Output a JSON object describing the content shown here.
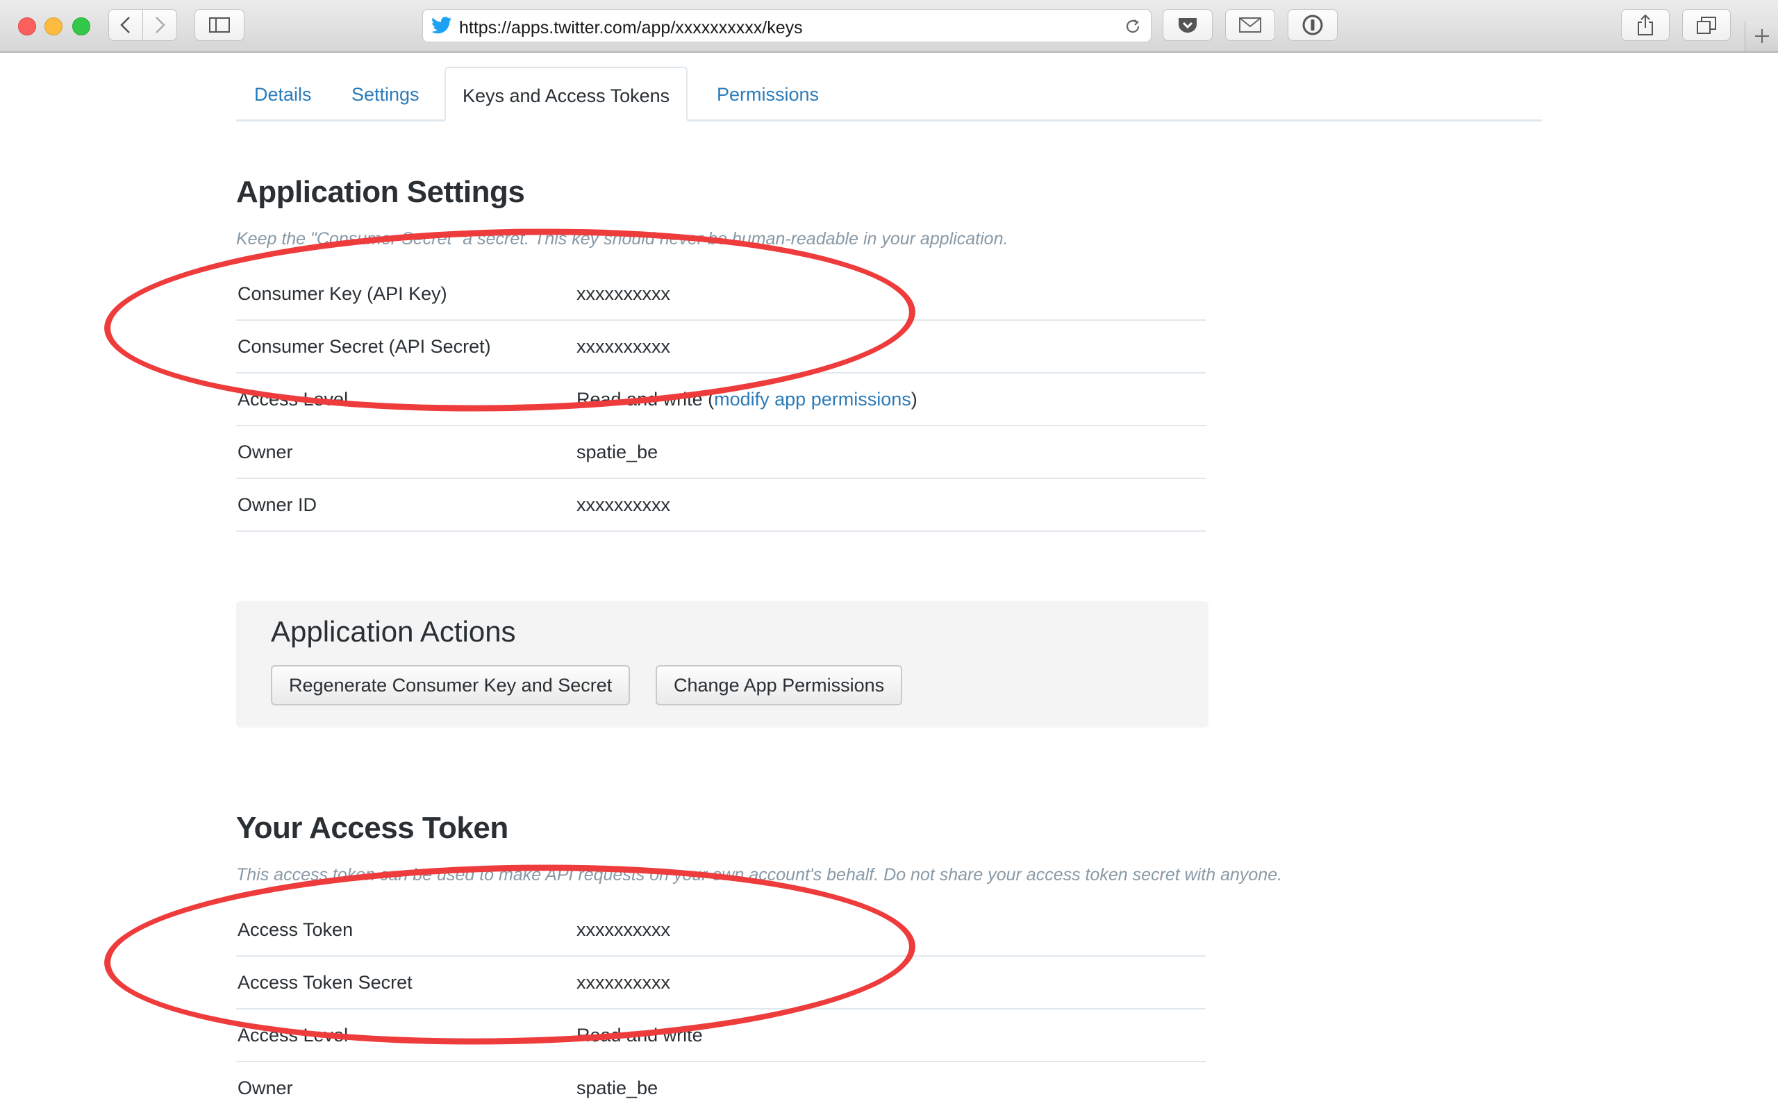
{
  "browser": {
    "url": "https://apps.twitter.com/app/xxxxxxxxxx/keys",
    "icons": [
      "back-icon",
      "forward-icon",
      "sidebar-icon",
      "twitter-bird-icon",
      "reload-icon",
      "pocket-icon",
      "mail-icon",
      "onepassword-icon",
      "share-icon",
      "tabs-icon",
      "new-tab-icon"
    ]
  },
  "tabs": [
    {
      "label": "Details"
    },
    {
      "label": "Settings"
    },
    {
      "label": "Keys and Access Tokens"
    },
    {
      "label": "Permissions"
    }
  ],
  "app_settings": {
    "title": "Application Settings",
    "description": "Keep the \"Consumer Secret\" a secret. This key should never be human-readable in your application.",
    "rows": [
      {
        "key": "Consumer Key (API Key)",
        "value": "xxxxxxxxxx"
      },
      {
        "key": "Consumer Secret (API Secret)",
        "value": "xxxxxxxxxx"
      },
      {
        "key": "Access Level",
        "value": "Read and write",
        "link_open": "(",
        "link": "modify app permissions",
        "link_close": ")"
      },
      {
        "key": "Owner",
        "value": "spatie_be"
      },
      {
        "key": "Owner ID",
        "value": "xxxxxxxxxx"
      }
    ]
  },
  "app_actions": {
    "title": "Application Actions",
    "regenerate_label": "Regenerate Consumer Key and Secret",
    "permissions_label": "Change App Permissions"
  },
  "access_token": {
    "title": "Your Access Token",
    "description": "This access token can be used to make API requests on your own account's behalf. Do not share your access token secret with anyone.",
    "rows": [
      {
        "key": "Access Token",
        "value": "xxxxxxxxxx"
      },
      {
        "key": "Access Token Secret",
        "value": "xxxxxxxxxx"
      },
      {
        "key": "Access Level",
        "value": "Read and write"
      },
      {
        "key": "Owner",
        "value": "spatie_be"
      }
    ]
  },
  "colors": {
    "link": "#2b7bb9",
    "annotation": "#ee3b3b"
  }
}
